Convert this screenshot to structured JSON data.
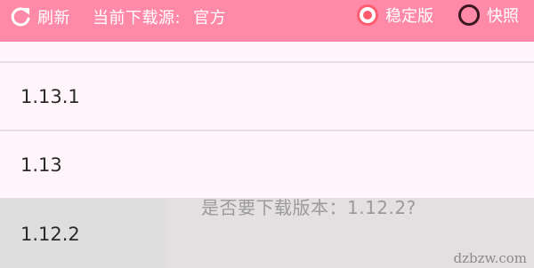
{
  "toolbar": {
    "refresh_label": "刷新",
    "source_label": "当前下载源:",
    "source_value": "官方",
    "options": [
      {
        "label": "稳定版",
        "checked": true
      },
      {
        "label": "快照",
        "checked": false
      }
    ]
  },
  "versions": [
    "1.13.1",
    "1.13",
    "1.12.2"
  ],
  "toast": "是否要下载版本：1.12.2?",
  "watermark": "dzbzw.com",
  "colors": {
    "toolbar_bg": "#ff8aa8",
    "radio_accent": "#ff5d6f",
    "list_bg": "#fff5fa"
  }
}
